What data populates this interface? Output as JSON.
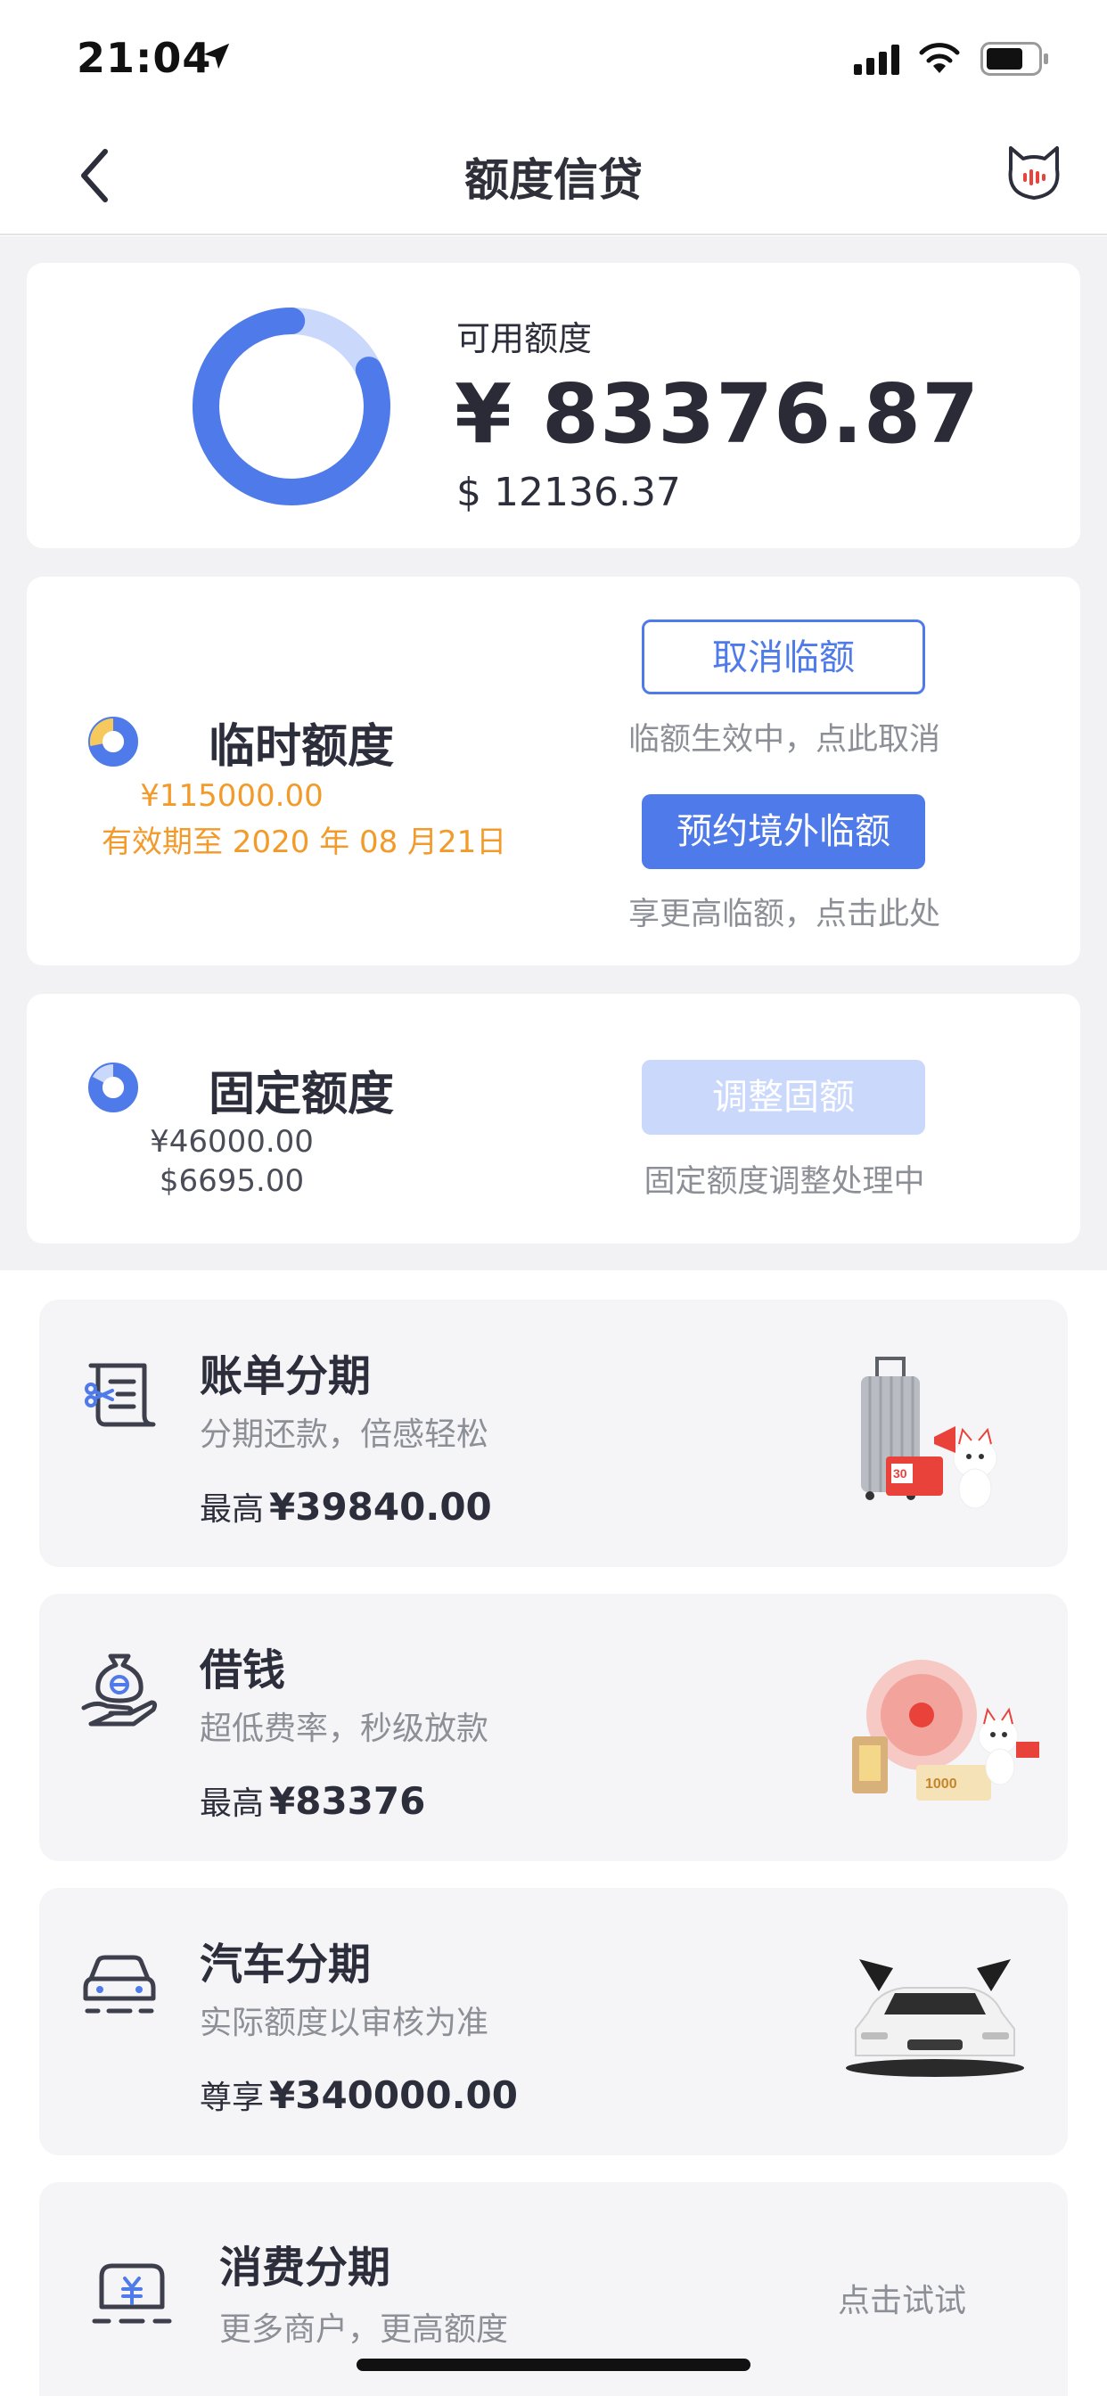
{
  "status_bar": {
    "time": "21:04"
  },
  "nav": {
    "title": "额度信贷"
  },
  "available": {
    "label": "可用额度",
    "cny": "¥ 83376.87",
    "usd": "$ 12136.37",
    "used_fraction": 0.18
  },
  "temporary": {
    "title": "临时额度",
    "amount": "¥115000.00",
    "expiry": "有效期至 2020 年 08 月21日",
    "cancel_button": "取消临额",
    "cancel_hint": "临额生效中，点此取消",
    "book_button": "预约境外临额",
    "book_hint": "享更高临额，点击此处"
  },
  "fixed": {
    "title": "固定额度",
    "cny": "¥46000.00",
    "usd": "$6695.00",
    "adjust_button": "调整固额",
    "adjust_hint": "固定额度调整处理中"
  },
  "products": [
    {
      "title": "账单分期",
      "subtitle": "分期还款，倍感轻松",
      "limit_prefix": "最高",
      "limit_value": "¥39840.00",
      "badge": "30"
    },
    {
      "title": "借钱",
      "subtitle": "超低费率，秒级放款",
      "limit_prefix": "最高",
      "limit_value": "¥83376",
      "badge": "1000"
    },
    {
      "title": "汽车分期",
      "subtitle": "实际额度以审核为准",
      "limit_prefix": "尊享",
      "limit_value": "¥340000.00"
    },
    {
      "title": "消费分期",
      "subtitle": "更多商户，更高额度",
      "action": "点击试试"
    }
  ],
  "colors": {
    "accent": "#4f7ae9",
    "accent_light": "#c9d8fb",
    "warning": "#f29a2a"
  },
  "icons": [
    "location-arrow-icon",
    "signal-icon",
    "wifi-icon",
    "battery-icon",
    "back-chevron-icon",
    "cat-assistant-icon",
    "bill-installment-icon",
    "loan-hand-icon",
    "car-icon",
    "shopping-box-icon"
  ]
}
